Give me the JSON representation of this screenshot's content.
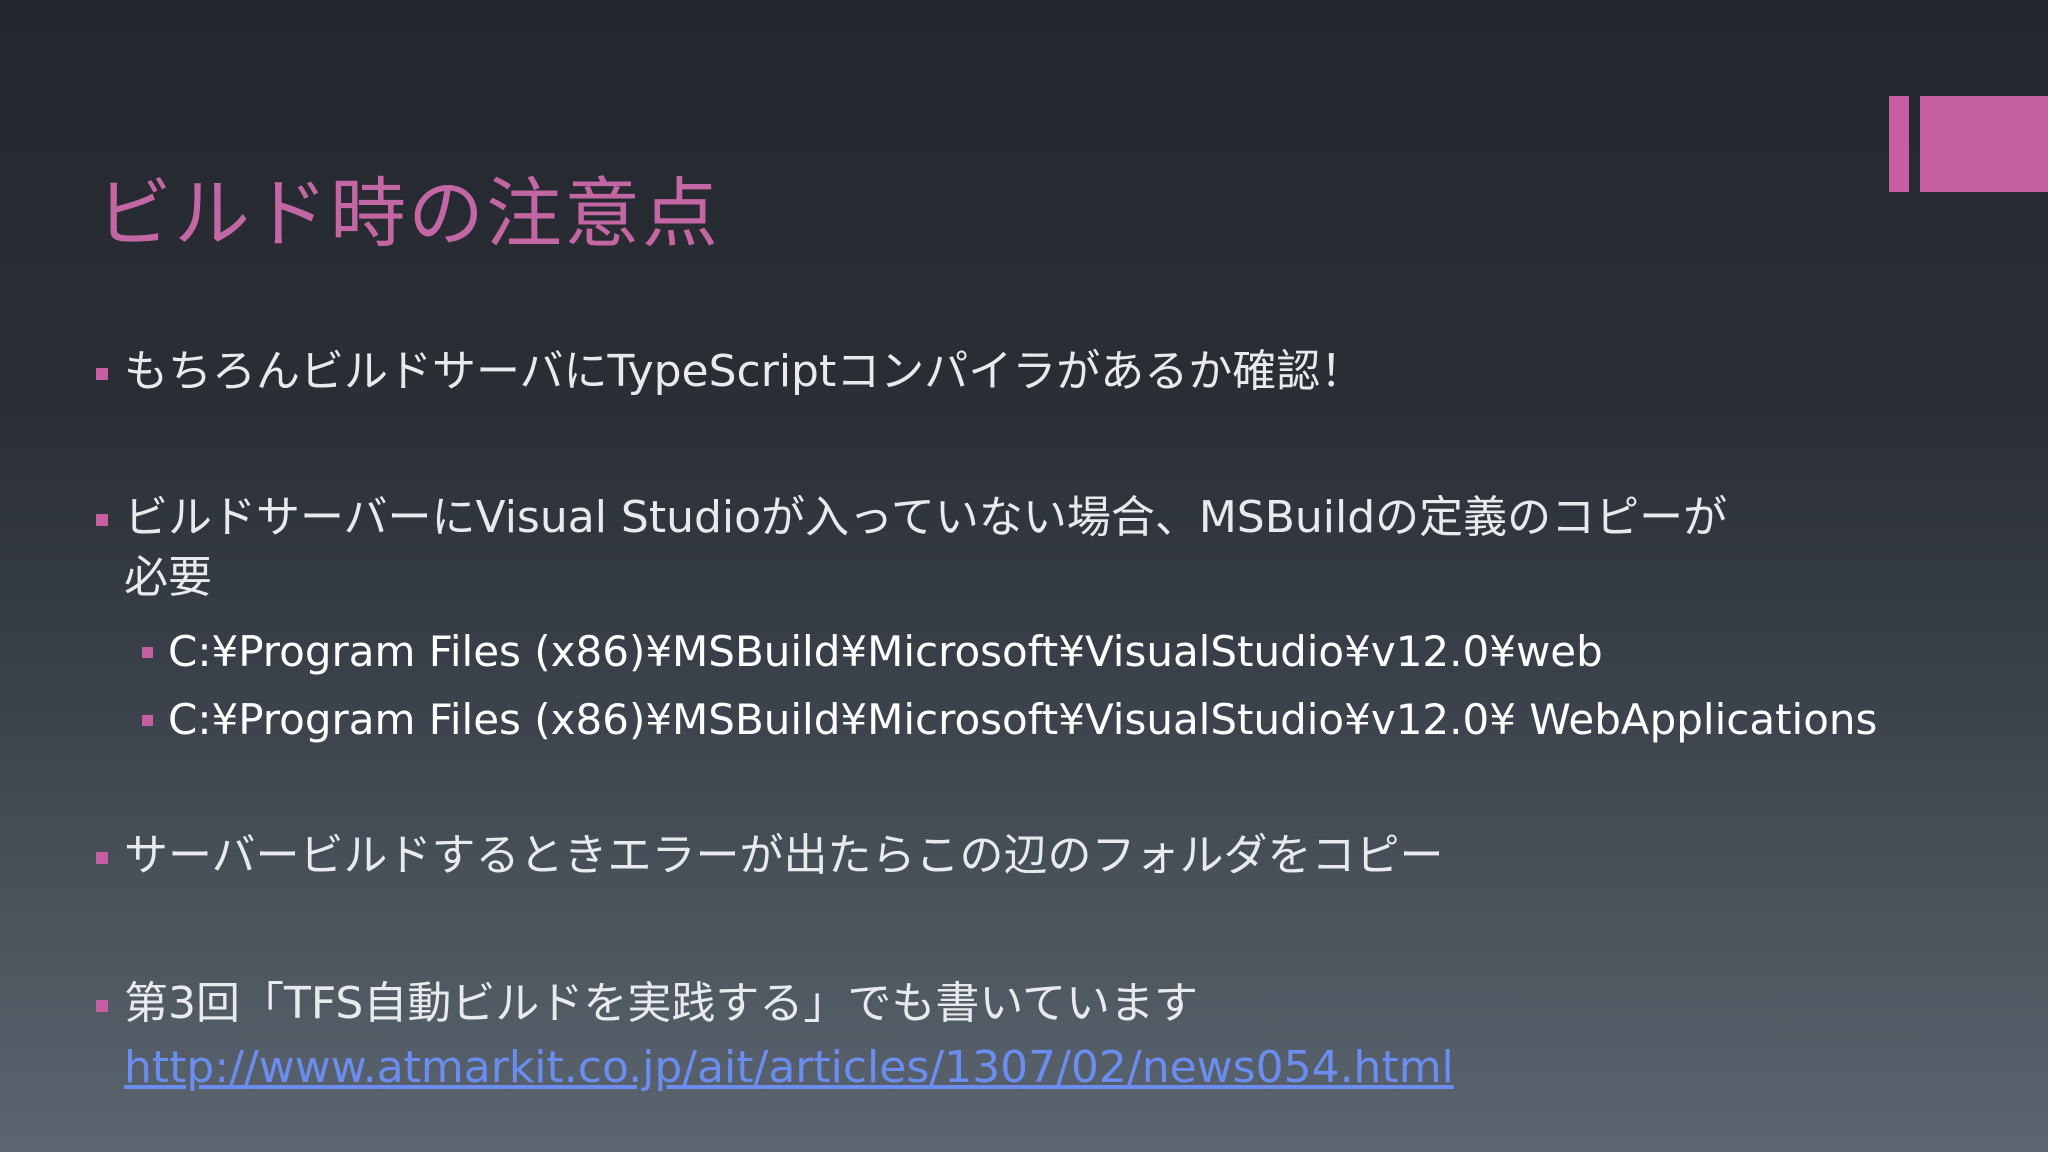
{
  "slide": {
    "title": "ビルド時の注意点",
    "accent_color": "#c65fa2",
    "bullets": [
      {
        "text": "もちろんビルドサーバにTypeScriptコンパイラがあるか確認！"
      },
      {
        "text": "ビルドサーバーにVisual Studioが入っていない場合、MSBuildの定義のコピーが",
        "text_cont": "必要"
      },
      {
        "text": "C:¥Program Files (x86)¥MSBuild¥Microsoft¥VisualStudio¥v12.0¥web"
      },
      {
        "text": "C:¥Program Files (x86)¥MSBuild¥Microsoft¥VisualStudio¥v12.0¥ WebApplications"
      },
      {
        "text": "サーバービルドするときエラーが出たらこの辺のフォルダをコピー"
      },
      {
        "text": "第3回「TFS自動ビルドを実践する」でも書いています",
        "link": "http://www.atmarkit.co.jp/ait/articles/1307/02/news054.html"
      }
    ]
  }
}
